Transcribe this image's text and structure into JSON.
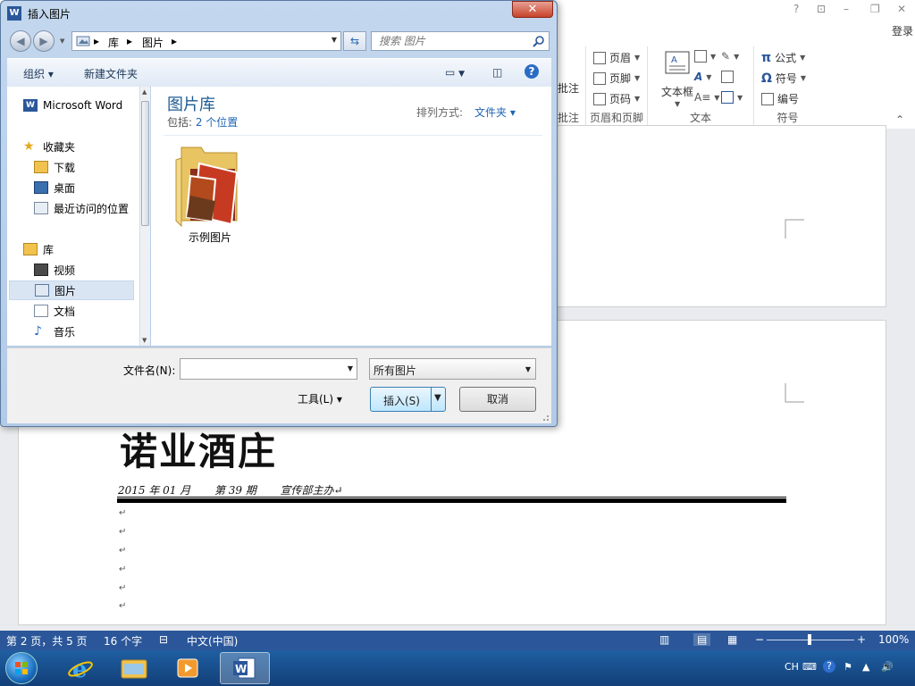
{
  "word": {
    "window_controls": {
      "help": "?",
      "ribbon_options": "⊡",
      "minimize": "–",
      "restore": "❐",
      "close": "✕"
    },
    "login": "登录",
    "ribbon": {
      "partial_group_item": "批注",
      "partial_group_label": "批注",
      "header_footer": {
        "header": "页眉",
        "footer": "页脚",
        "page_number": "页码",
        "label": "页眉和页脚"
      },
      "text": {
        "textbox": "文本框",
        "label": "文本"
      },
      "symbols": {
        "equation": "公式",
        "symbol": "符号",
        "numbering": "编号",
        "label": "符号"
      }
    },
    "document": {
      "title": "诺业酒庄",
      "subtitle": "2015 年 01 月       第 39 期       宣传部主办↵",
      "para_mark": "↵"
    },
    "status_bar": {
      "page_info": "第 2 页，共 5 页",
      "word_count": "16 个字",
      "language": "中文(中国)",
      "zoom_minus": "−",
      "zoom_plus": "+",
      "zoom": "100%",
      "zoom_level": 1.0
    }
  },
  "taskbar": {
    "tray": {
      "lang": "CH"
    }
  },
  "dialog": {
    "title": "插入图片",
    "close": "✕",
    "address": {
      "root_sep": "▸",
      "seg1": "库",
      "seg2": "图片"
    },
    "search_placeholder": "搜索 图片",
    "toolbar": {
      "organize": "组织 ▾",
      "new_folder": "新建文件夹"
    },
    "nav": {
      "items": [
        {
          "label": "Microsoft Word"
        },
        {
          "label": "收藏夹"
        },
        {
          "label": "下载"
        },
        {
          "label": "桌面"
        },
        {
          "label": "最近访问的位置"
        },
        {
          "label": "库"
        },
        {
          "label": "视频"
        },
        {
          "label": "图片"
        },
        {
          "label": "文档"
        },
        {
          "label": "音乐"
        }
      ]
    },
    "content": {
      "library_title": "图片库",
      "includes_prefix": "包括: ",
      "includes_link": "2 个位置",
      "sort_label": "排列方式:",
      "sort_value": "文件夹 ▾",
      "folder_name": "示例图片"
    },
    "bottom": {
      "filename_label": "文件名(N):",
      "filename_value": "",
      "filter_value": "所有图片",
      "tools": "工具(L)  ▾",
      "insert": "插入(S)",
      "cancel": "取消"
    }
  },
  "colors": {
    "word_blue": "#2b579a",
    "link_blue": "#1e64b4",
    "library_title": "#1e5b93"
  }
}
